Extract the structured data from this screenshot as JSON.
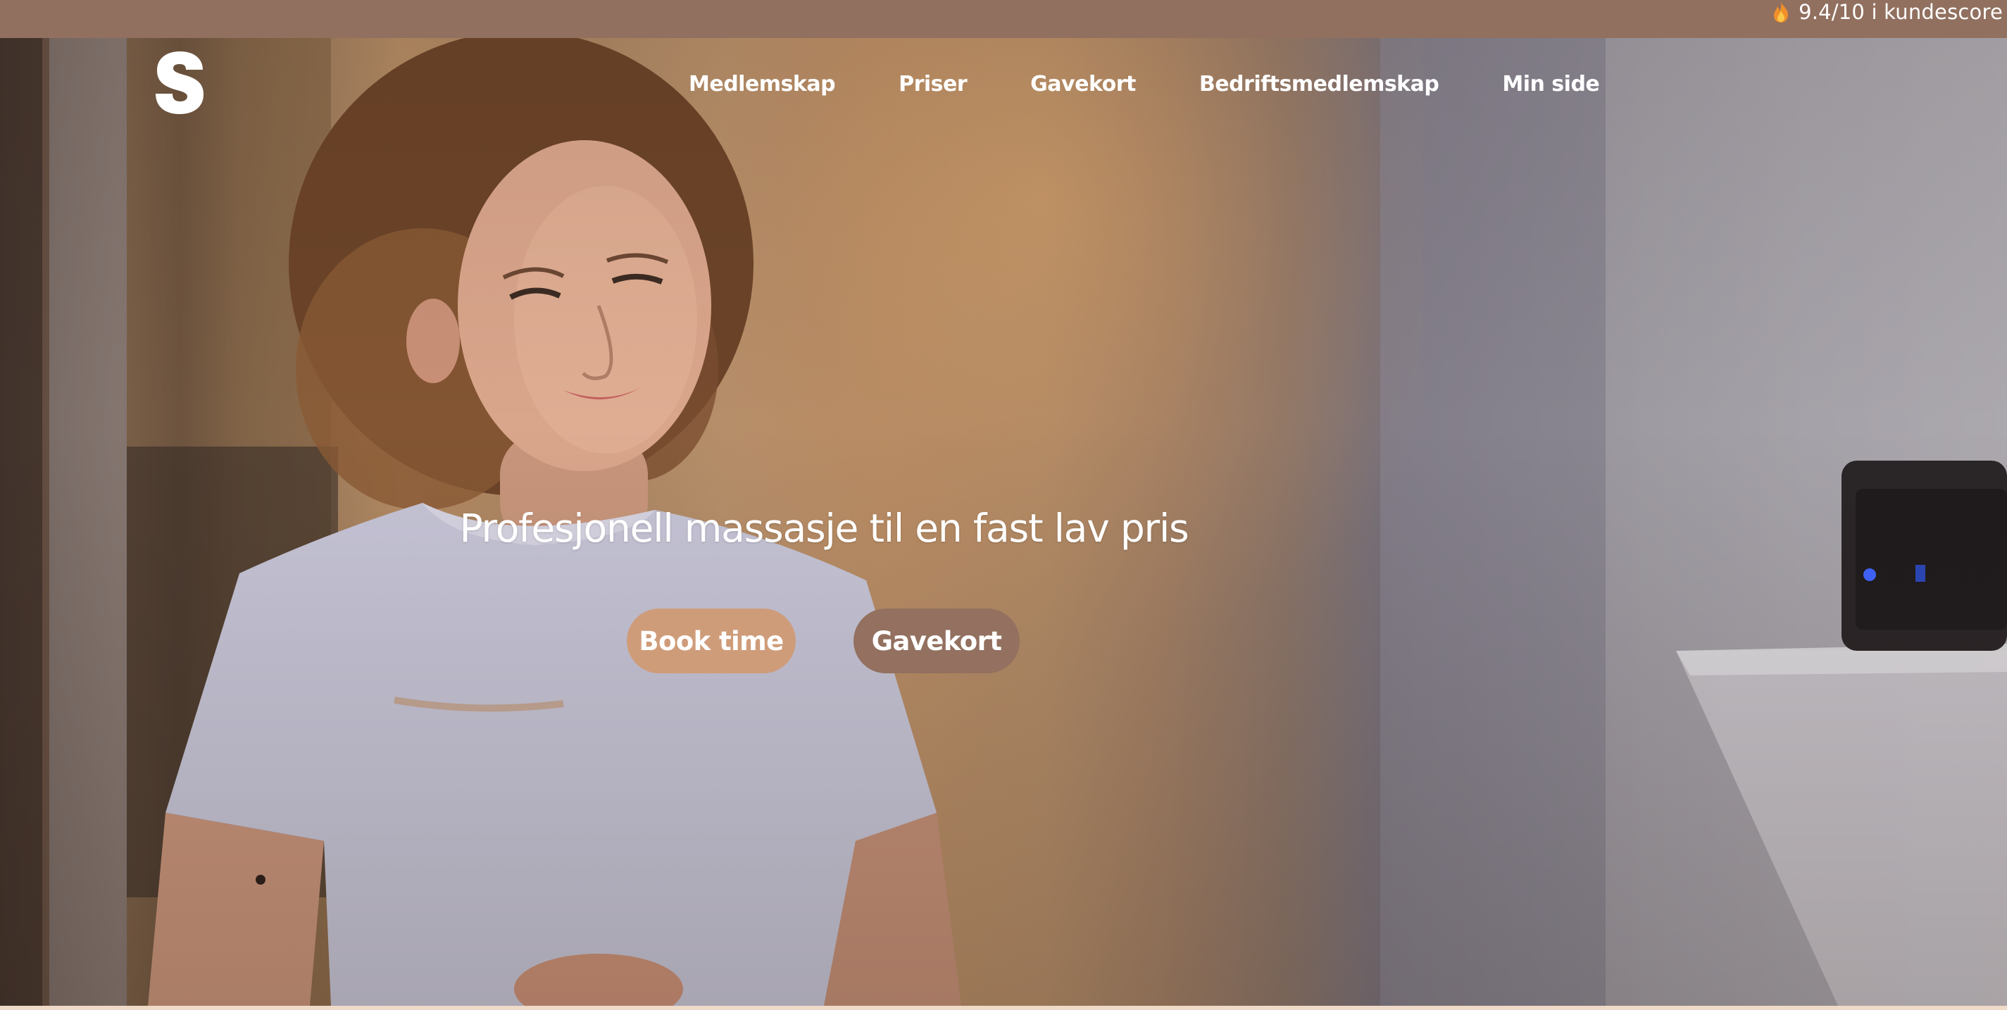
{
  "topbar": {
    "score_text": "9.4/10 i kundescore",
    "icon": "flame-icon"
  },
  "header": {
    "logo_icon": "s-logo-icon",
    "nav": [
      {
        "label": "Medlemskap"
      },
      {
        "label": "Priser"
      },
      {
        "label": "Gavekort"
      },
      {
        "label": "Bedriftsmedlemskap"
      },
      {
        "label": "Min side"
      }
    ]
  },
  "hero": {
    "headline": "Profesjonell massasje til en fast lav pris",
    "primary_button": "Book time",
    "secondary_button": "Gavekort",
    "background_image": "therapist-video-still"
  },
  "colors": {
    "topbar": "#92705f",
    "primary_button": "#cf9c7a",
    "secondary_button": "#93705f",
    "text": "#ffffff"
  }
}
